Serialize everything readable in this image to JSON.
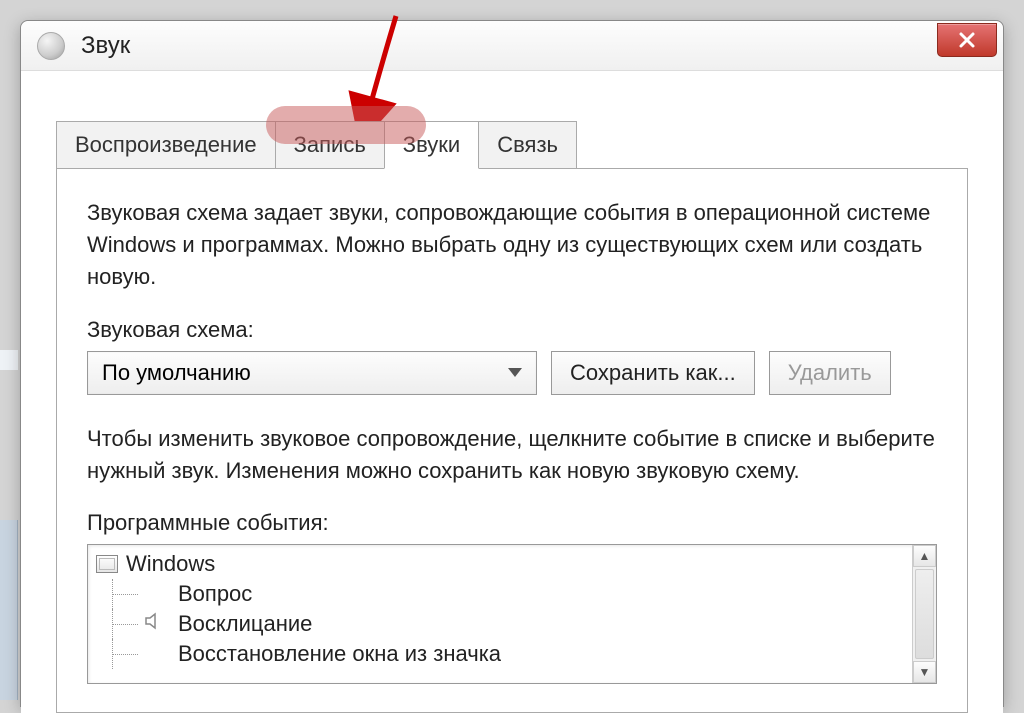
{
  "window": {
    "title": "Звук",
    "close_label": "X"
  },
  "tabs": {
    "playback": "Воспроизведение",
    "recording": "Запись",
    "sounds": "Звуки",
    "communications": "Связь"
  },
  "panel": {
    "description1": "Звуковая схема задает звуки, сопровождающие события в операционной системе Windows и программах. Можно выбрать одну из существующих схем или создать новую.",
    "scheme_label": "Звуковая схема:",
    "scheme_value": "По умолчанию",
    "save_as": "Сохранить как...",
    "delete": "Удалить",
    "description2": "Чтобы изменить звуковое сопровождение, щелкните событие в списке и выберите нужный звук. Изменения можно сохранить как новую звуковую схему.",
    "events_label": "Программные события:",
    "tree": {
      "root": "Windows",
      "items": [
        "Вопрос",
        "Восклицание",
        "Восстановление окна из значка"
      ]
    }
  }
}
